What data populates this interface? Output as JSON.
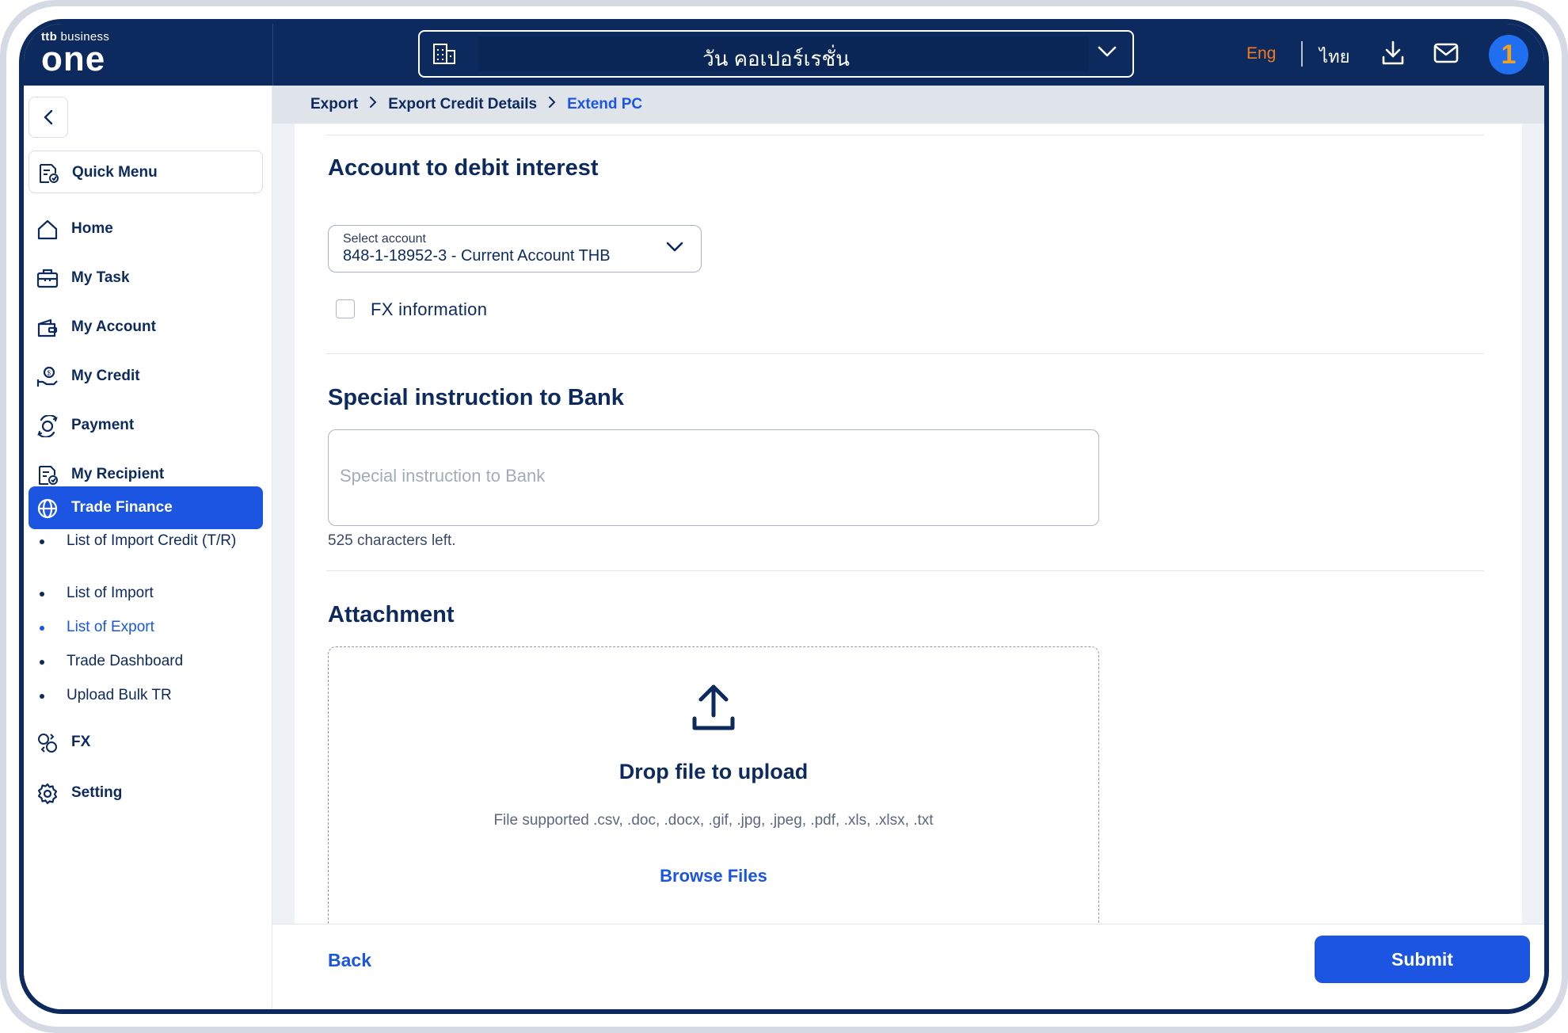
{
  "brand": {
    "logo_top_bold": "ttb",
    "logo_top_thin": "business",
    "logo_main": "one"
  },
  "header": {
    "company_name": "วัน คอเปอร์เรชั่น",
    "lang_eng": "Eng",
    "lang_thai": "ไทย",
    "avatar_digit": "1",
    "accent_color": "#f37b21",
    "primary_color": "#1b55e2",
    "navy_color": "#0d2a5e"
  },
  "breadcrumb": {
    "items": [
      "Export",
      "Export Credit Details",
      "Extend PC"
    ]
  },
  "sidebar": {
    "quick_menu": "Quick Menu",
    "items": [
      {
        "label": "Home",
        "icon": "home-icon"
      },
      {
        "label": "My Task",
        "icon": "briefcase-icon"
      },
      {
        "label": "My Account",
        "icon": "wallet-icon"
      },
      {
        "label": "My Credit",
        "icon": "credit-hand-icon"
      },
      {
        "label": "Payment",
        "icon": "payment-icon"
      },
      {
        "label": "My Recipient",
        "icon": "recipient-icon"
      },
      {
        "label": "Trade Finance",
        "icon": "globe-icon"
      },
      {
        "label": "FX",
        "icon": "fx-icon"
      },
      {
        "label": "Setting",
        "icon": "gear-icon"
      }
    ],
    "sub_items": [
      "List of Import Credit (T/R)",
      "List of Import",
      "List of Export",
      "Trade Dashboard",
      "Upload Bulk TR"
    ]
  },
  "form": {
    "debit_title": "Account to debit interest",
    "select_label": "Select account",
    "select_value": "848-1-18952-3 - Current Account THB",
    "fx_label": "FX information",
    "instruction_title": "Special instruction to Bank",
    "instruction_placeholder": "Special instruction to Bank",
    "chars_left": "525 characters left.",
    "attachment_title": "Attachment",
    "drop_title": "Drop file to upload",
    "supported": "File supported .csv, .doc, .docx, .gif, .jpg, .jpeg, .pdf, .xls, .xlsx, .txt",
    "browse": "Browse Files"
  },
  "footer": {
    "back": "Back",
    "submit": "Submit"
  }
}
